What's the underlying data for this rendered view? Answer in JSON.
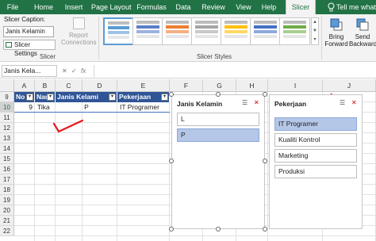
{
  "ribbon_tabs": [
    {
      "label": "File"
    },
    {
      "label": "Home"
    },
    {
      "label": "Insert"
    },
    {
      "label": "Page Layout"
    },
    {
      "label": "Formulas"
    },
    {
      "label": "Data"
    },
    {
      "label": "Review"
    },
    {
      "label": "View"
    },
    {
      "label": "Help"
    },
    {
      "label": "Slicer"
    },
    {
      "label": "Tell me what"
    }
  ],
  "slicer_group": {
    "caption_label": "Slicer Caption:",
    "caption_value": "Janis Kelamin",
    "settings_label": "Slicer Settings",
    "report_connections_line1": "Report",
    "report_connections_line2": "Connections",
    "group_label": "Slicer"
  },
  "slicer_styles": {
    "group_label": "Slicer Styles",
    "styles": [
      {
        "color": "#5b9bd5"
      },
      {
        "color": "#5b7ec8"
      },
      {
        "color": "#ed7d31"
      },
      {
        "color": "#a5a5a5"
      },
      {
        "color": "#ffc000"
      },
      {
        "color": "#4472c4"
      },
      {
        "color": "#70ad47"
      }
    ]
  },
  "arrange": {
    "bring_forward_line1": "Bring",
    "bring_forward_line2": "Forward",
    "send_backward_line1": "Send",
    "send_backward_line2": "Backward"
  },
  "formula_bar": {
    "name_box": "Janis Kela...",
    "fx_label": "fx"
  },
  "columns": [
    "A",
    "B",
    "C",
    "D",
    "E",
    "F",
    "G",
    "H",
    "I",
    "J"
  ],
  "rows": [
    "9",
    "10",
    "11",
    "12",
    "13",
    "14",
    "15",
    "16",
    "17",
    "18",
    "19",
    "20",
    "21",
    "22"
  ],
  "table": {
    "headers": [
      "No",
      "Nam",
      "Janis Kelami",
      "Pekerjaan"
    ],
    "row": [
      "9",
      "Tika",
      "P",
      "IT Programer"
    ]
  },
  "slicer_gender": {
    "title": "Janis Kelamin",
    "items": [
      {
        "label": "L",
        "selected": false
      },
      {
        "label": "P",
        "selected": true
      }
    ]
  },
  "slicer_job": {
    "title": "Pekerjaan",
    "items": [
      {
        "label": "IT Programer",
        "selected": true
      },
      {
        "label": "Kualiti Kontrol",
        "selected": false
      },
      {
        "label": "Marketing",
        "selected": false
      },
      {
        "label": "Produksi",
        "selected": false
      }
    ]
  },
  "colors": {
    "excel_green": "#217346",
    "table_header": "#2f5597",
    "slicer_selected": "#b4c7e7",
    "annotation_red": "#e8141c"
  }
}
